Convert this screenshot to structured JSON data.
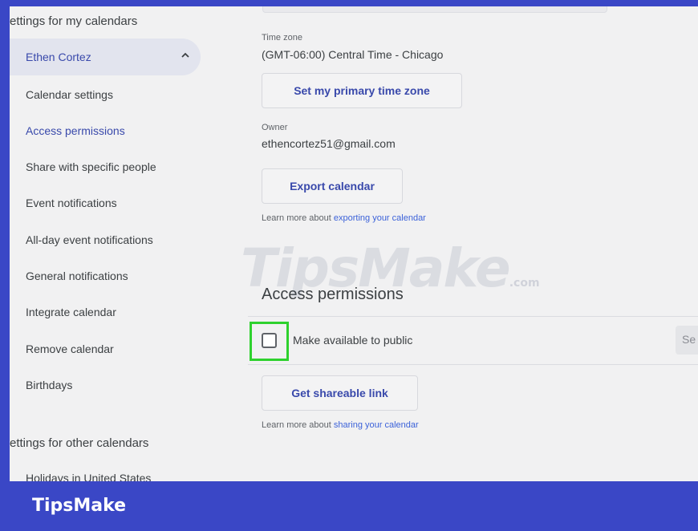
{
  "sidebar": {
    "section_my": "ettings for my calendars",
    "selected_calendar": "Ethen Cortez",
    "items": [
      "Calendar settings",
      "Access permissions",
      "Share with specific people",
      "Event notifications",
      "All-day event notifications",
      "General notifications",
      "Integrate calendar",
      "Remove calendar",
      "Birthdays"
    ],
    "section_other": "ettings for other calendars",
    "other_item": "Holidays in United States"
  },
  "main": {
    "timezone_label": "Time zone",
    "timezone_value": "(GMT-06:00) Central Time - Chicago",
    "set_timezone_button": "Set my primary time zone",
    "owner_label": "Owner",
    "owner_value": "ethencortez51@gmail.com",
    "export_button": "Export calendar",
    "export_learn_prefix": "Learn more about ",
    "export_learn_link": "exporting your calendar",
    "section_title": "Access permissions",
    "public_checkbox_label": "Make available to public",
    "see_button": "Se",
    "shareable_link_button": "Get shareable link",
    "share_learn_prefix": "Learn more about ",
    "share_learn_link": "sharing your calendar",
    "public_checked": false
  },
  "watermark": {
    "text": "TipsMake",
    "suffix": ".com"
  },
  "footer": {
    "logo": "TipsMake"
  },
  "colors": {
    "frame": "#3a47c6",
    "accent_text": "#3949ab",
    "highlight": "#2ed12e"
  }
}
